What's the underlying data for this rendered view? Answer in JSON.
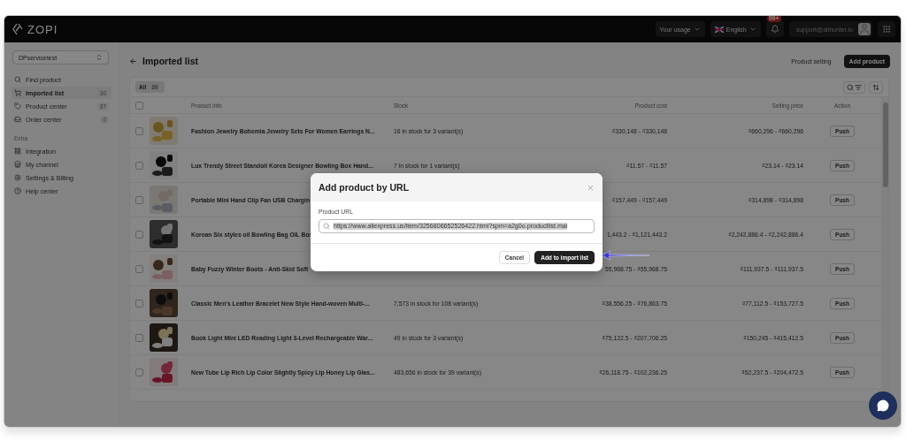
{
  "topbar": {
    "logo": "ZOPI",
    "usage": "Your usage",
    "language": "English",
    "notifications": "99+",
    "account": "support@alihunter.io"
  },
  "sidebar": {
    "store": "DPservicetest",
    "items": [
      {
        "label": "Find product",
        "selected": false
      },
      {
        "label": "Imported list",
        "count": "30",
        "selected": true
      },
      {
        "label": "Product center",
        "count": "37",
        "selected": false
      },
      {
        "label": "Order center",
        "count": "0",
        "selected": false
      }
    ],
    "section": "Extra",
    "extra_items": [
      {
        "label": "Integration",
        "selected": false
      },
      {
        "label": "My channel",
        "selected": false
      },
      {
        "label": "Settings & Billing",
        "selected": false
      },
      {
        "label": "Help center",
        "selected": false
      }
    ]
  },
  "page": {
    "title": "Imported list",
    "secondary_action": "Product setting",
    "primary_action": "Add product"
  },
  "table": {
    "filter_tab": {
      "label": "All",
      "count": "30",
      "selected": true
    },
    "select_all_checked": false,
    "columns": [
      "Product info",
      "Stock",
      "Product cost",
      "Selling price",
      "Action"
    ],
    "rows": [
      {
        "checked": false,
        "name": "Fashion Jewelry Bohemia Jewelry Sets For Women Earrings N...",
        "stock": "16 in stock for 3 variant(s)",
        "cost": "₫330,148 - ₫330,148",
        "price": "₫660,296 - ₫660,296",
        "action": "Push"
      },
      {
        "checked": false,
        "name": "Lux Trendy Street Standoil Korea Designer Bowling Box Hand...",
        "stock": "7 in stock for 1 variant(s)",
        "cost": "₫11.57 - ₫11.57",
        "price": "₫23.14 - ₫23.14",
        "action": "Push"
      },
      {
        "checked": false,
        "name": "Portable Mini Hand Clip Fan USB Chargin",
        "cost": "₫157,449 - ₫157,449",
        "price": "₫314,898 - ₫314,898",
        "action": "Push"
      },
      {
        "checked": false,
        "name": "Korean Six styles oil Bowling Bag OIL Bos",
        "cost": "1,443.2 - ₫1,121,443.2",
        "price": "₫2,242,886.4 - ₫2,242,886.4",
        "action": "Push"
      },
      {
        "checked": false,
        "name": "Baby Fuzzy Winter Boots - Anti-Skid Soft",
        "cost": "55,968.75 - ₫55,968.75",
        "price": "₫111,937.5 - ₫111,937.5",
        "action": "Push"
      },
      {
        "checked": false,
        "name": "Classic Men's Leather Bracelet New Style Hand-woven Multi-...",
        "stock": "7,573 in stock for 108 variant(s)",
        "cost": "₫38,556.25 - ₫76,863.75",
        "price": "₫77,112.5 - ₫153,727.5",
        "action": "Push"
      },
      {
        "checked": false,
        "name": "Book Light Mini LED Reading Light 3-Level Rechargeable War...",
        "stock": "49 in stock for 3 variant(s)",
        "cost": "₫75,122.5 - ₫207,706.25",
        "price": "₫150,245 - ₫415,412.5",
        "action": "Push"
      },
      {
        "checked": false,
        "name": "New Tube Lip Rich Lip Color Slightly Spicy Lip Honey Lip Glas...",
        "stock": "483,656 in stock for 39 variant(s)",
        "cost": "₫26,118.75 - ₫102,236.25",
        "price": "₫52,237.5 - ₫204,472.5",
        "action": "Push"
      }
    ]
  },
  "modal": {
    "title": "Add product by URL",
    "field_label": "Product URL",
    "value": "https://www.aliexpress.us/item/3256806652526422.html?spm=a2g0o.productlist.mai",
    "value_selected": true,
    "buttons": [
      {
        "label": "Cancel",
        "kind": "secondary"
      },
      {
        "label": "Add to import list",
        "kind": "primary"
      }
    ]
  }
}
